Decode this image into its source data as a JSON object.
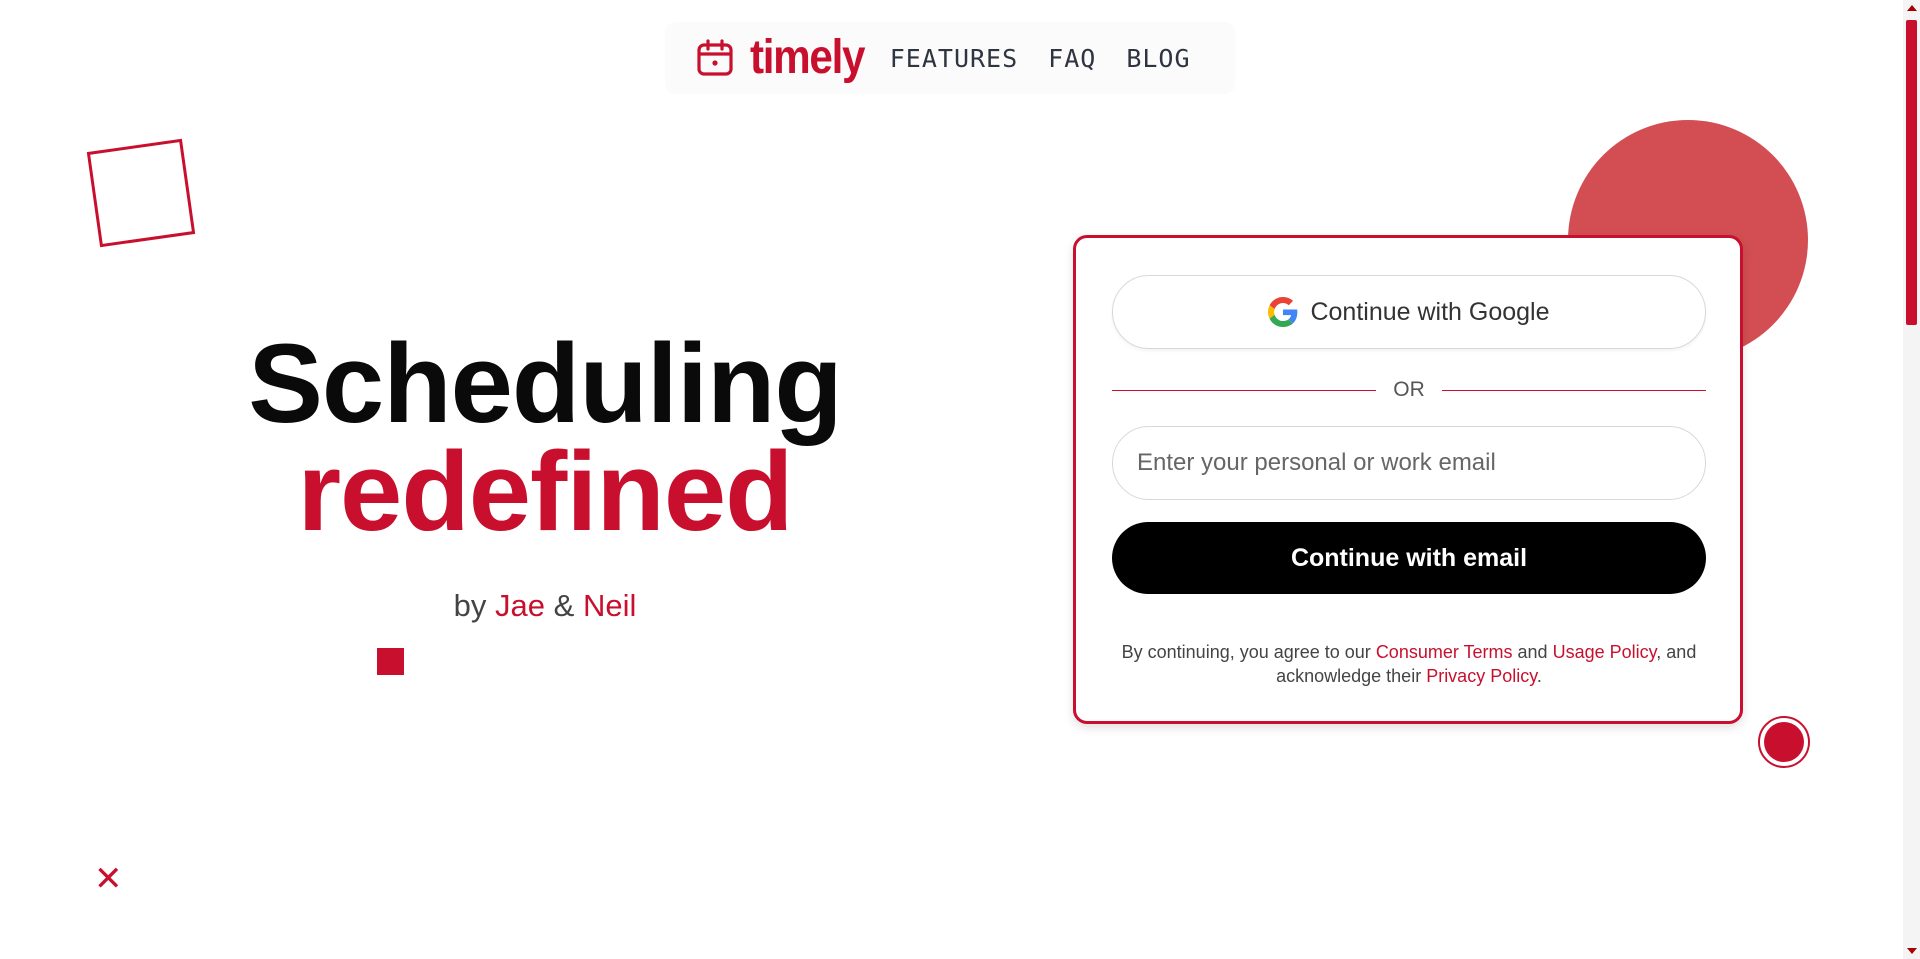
{
  "nav": {
    "logo_icon": "calendar-icon",
    "logo_text": "timely",
    "links": [
      "FEATURES",
      "FAQ",
      "BLOG"
    ]
  },
  "hero": {
    "line1": "Scheduling",
    "line2": "redefined",
    "by": "by",
    "author1": "Jae",
    "amp": "&",
    "author2": "Neil"
  },
  "signin": {
    "google_icon": "google-icon",
    "google_label": "Continue with Google",
    "or": "OR",
    "email_placeholder": "Enter your personal or work email",
    "email_value": "",
    "email_button": "Continue with email",
    "legal": {
      "text1": "By continuing, you agree to our ",
      "link1": "Consumer Terms",
      "text2": " and ",
      "link2": "Usage Policy",
      "text3": ", and acknowledge their ",
      "link3": "Privacy Policy",
      "text4": "."
    }
  },
  "colors": {
    "brand": "#c8102e",
    "circle": "#d24e52",
    "text_dark": "#0a0a0a",
    "button_bg": "#000000"
  }
}
